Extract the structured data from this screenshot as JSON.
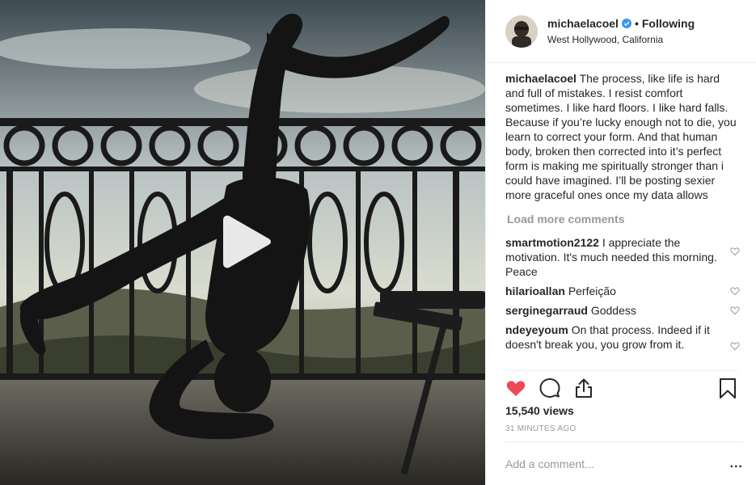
{
  "user": {
    "username": "michaelacoel",
    "separator": "•",
    "follow_status": "Following",
    "location": "West Hollywood, California"
  },
  "caption": {
    "username": "michaelacoel",
    "text": "The process, like life is hard and full of mistakes. I resist comfort sometimes. I like hard floors. I like hard falls. Because if you’re lucky enough not to die, you learn to correct your form. And that human body, broken then corrected into it’s perfect form is making me spiritually stronger than i could have imagined. I’ll be posting sexier more graceful ones once my data allows"
  },
  "load_more": "Load more comments",
  "comments": [
    {
      "username": "smartmotion2122",
      "text": "I appreciate the motivation. It's much needed this morning. Peace"
    },
    {
      "username": "hilarioallan",
      "text": "Perfeição"
    },
    {
      "username": "serginegarraud",
      "text": "Goddess"
    },
    {
      "username": "ndeyeyoum",
      "text": "On that process. Indeed if it doesn't break you, you grow from it."
    }
  ],
  "stats": {
    "views": "15,540 views",
    "time": "31 MINUTES AGO"
  },
  "add_comment": {
    "placeholder": "Add a comment...",
    "more": "..."
  },
  "colors": {
    "like_red": "#ed4956",
    "verified_blue": "#3897f0",
    "muted": "#999999"
  }
}
